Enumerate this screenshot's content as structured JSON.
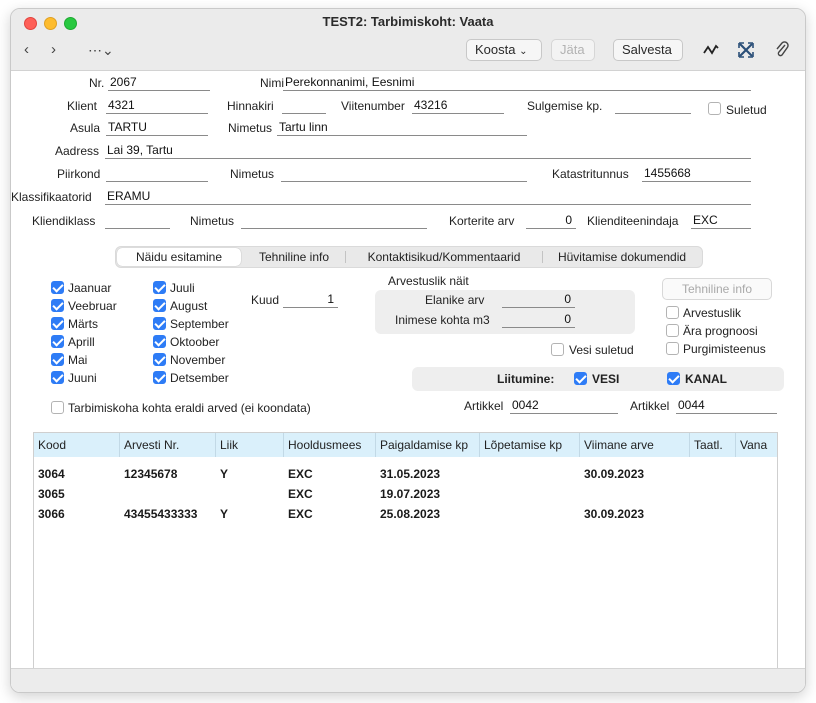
{
  "window": {
    "title": "TEST2: Tarbimiskoht: Vaata"
  },
  "toolbar": {
    "koosta_label": "Koosta",
    "jata_label": "Jäta",
    "salvesta_label": "Salvesta"
  },
  "form": {
    "nr_label": "Nr.",
    "nr_value": "2067",
    "nimi_label": "Nimi",
    "nimi_value": "Perekonnanimi, Eesnimi",
    "klient_label": "Klient",
    "klient_value": "4321",
    "hinnakiri_label": "Hinnakiri",
    "hinnakiri_value": "",
    "viitenumber_label": "Viitenumber",
    "viitenumber_value": "43216",
    "sulgemise_label": "Sulgemise kp.",
    "sulgemise_value": "",
    "suletud_label": "Suletud",
    "asula_label": "Asula",
    "asula_value": "TARTU",
    "asula_nimetus_label": "Nimetus",
    "asula_nimetus_value": "Tartu linn",
    "aadress_label": "Aadress",
    "aadress_value": "Lai 39, Tartu",
    "piirkond_label": "Piirkond",
    "piirkond_value": "",
    "piirkond_nimetus_label": "Nimetus",
    "piirkond_nimetus_value": "",
    "katastritunnus_label": "Katastritunnus",
    "katastritunnus_value": "1455668",
    "klassifikaatorid_label": "Klassifikaatorid",
    "klassifikaatorid_value": "ERAMU",
    "kliendiklass_label": "Kliendiklass",
    "kliendiklass_value": "",
    "kliendiklass_nimetus_label": "Nimetus",
    "kliendiklass_nimetus_value": "",
    "korterite_label": "Korterite arv",
    "korterite_value": "0",
    "klienditeenindaja_label": "Klienditeenindaja",
    "klienditeenindaja_value": "EXC"
  },
  "tabs": [
    {
      "label": "Näidu esitamine"
    },
    {
      "label": "Tehniline info"
    },
    {
      "label": "Kontaktisikud/Kommentaarid"
    },
    {
      "label": "Hüvitamise dokumendid"
    }
  ],
  "months": [
    {
      "label": "Jaanuar",
      "checked": true
    },
    {
      "label": "Veebruar",
      "checked": true
    },
    {
      "label": "Märts",
      "checked": true
    },
    {
      "label": "Aprill",
      "checked": true
    },
    {
      "label": "Mai",
      "checked": true
    },
    {
      "label": "Juuni",
      "checked": true
    },
    {
      "label": "Juuli",
      "checked": true
    },
    {
      "label": "August",
      "checked": true
    },
    {
      "label": "September",
      "checked": true
    },
    {
      "label": "Oktoober",
      "checked": true
    },
    {
      "label": "November",
      "checked": true
    },
    {
      "label": "Detsember",
      "checked": true
    }
  ],
  "kuud": {
    "label": "Kuud",
    "value": "1"
  },
  "arvestuslik": {
    "title": "Arvestuslik näit",
    "elanike_label": "Elanike arv",
    "elanike_value": "0",
    "inimese_label": "Inimese kohta m3",
    "inimese_value": "0"
  },
  "vesi_suletud_label": "Vesi suletud",
  "tehniline_button": "Tehniline info",
  "right_checks": [
    {
      "label": "Arvestuslik",
      "checked": false
    },
    {
      "label": "Ära prognoosi",
      "checked": false
    },
    {
      "label": "Purgimisteenus",
      "checked": false
    }
  ],
  "liitumine": {
    "label": "Liitumine:",
    "vesi_label": "VESI",
    "vesi_checked": true,
    "kanal_label": "KANAL",
    "kanal_checked": true
  },
  "eraldi_arved_label": "Tarbimiskoha kohta eraldi arved (ei koondata)",
  "artikkel1": {
    "label": "Artikkel",
    "value": "0042"
  },
  "artikkel2": {
    "label": "Artikkel",
    "value": "0044"
  },
  "table": {
    "headers": [
      "Kood",
      "Arvesti Nr.",
      "Liik",
      "Hooldusmees",
      "Paigaldamise kp",
      "Lõpetamise kp",
      "Viimane arve",
      "Taatl.",
      "Vana"
    ],
    "rows": [
      [
        "3064",
        "12345678",
        "Y",
        "EXC",
        "31.05.2023",
        "",
        "30.09.2023",
        "",
        ""
      ],
      [
        "3065",
        "",
        "",
        "EXC",
        "19.07.2023",
        "",
        "",
        "",
        ""
      ],
      [
        "3066",
        "43455433333",
        "Y",
        "EXC",
        "25.08.2023",
        "",
        "30.09.2023",
        "",
        ""
      ]
    ]
  },
  "colors": {
    "accent": "#2e7cf6",
    "header_bg": "#daf0fb"
  }
}
